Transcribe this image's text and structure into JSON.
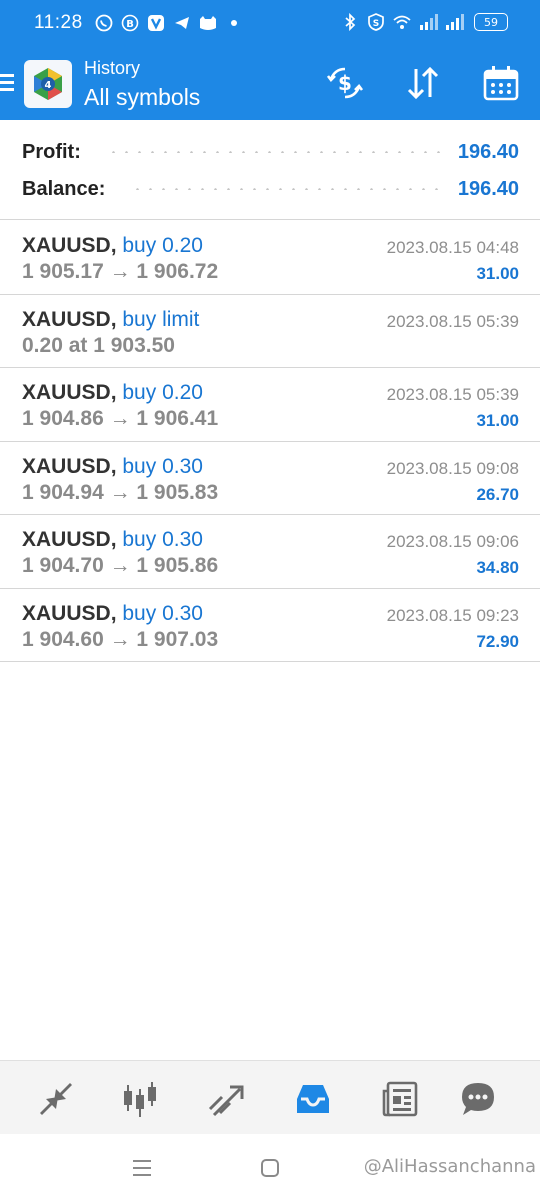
{
  "status_bar": {
    "time": "11:28",
    "battery": "59",
    "left_icons": [
      "whatsapp-icon",
      "b-icon",
      "v-icon",
      "telegram-icon",
      "cat-icon",
      "dot-icon"
    ],
    "right_icons": [
      "bluetooth-icon",
      "vpn-shield-icon",
      "wifi-icon",
      "signal-icon",
      "signal-icon",
      "battery-icon"
    ]
  },
  "header": {
    "title": "History",
    "subtitle": "All symbols",
    "actions": [
      "currency-exchange-icon",
      "sort-icon",
      "calendar-icon"
    ]
  },
  "summary": {
    "profit_label": "Profit:",
    "profit_value": "196.40",
    "balance_label": "Balance:",
    "balance_value": "196.40"
  },
  "deals": [
    {
      "symbol": "XAUUSD",
      "comma": ",",
      "side": "buy 0.20",
      "prices": "1 905.17 → 1 906.72",
      "time": "2023.08.15 04:48",
      "profit": "31.00"
    },
    {
      "symbol": "XAUUSD",
      "comma": ",",
      "side": "buy limit",
      "prices": "0.20 at 1 903.50",
      "time": "2023.08.15 05:39",
      "profit": ""
    },
    {
      "symbol": "XAUUSD",
      "comma": ",",
      "side": "buy 0.20",
      "prices": "1 904.86 → 1 906.41",
      "time": "2023.08.15 05:39",
      "profit": "31.00"
    },
    {
      "symbol": "XAUUSD",
      "comma": ",",
      "side": "buy 0.30",
      "prices": "1 904.94 → 1 905.83",
      "time": "2023.08.15 09:08",
      "profit": "26.70"
    },
    {
      "symbol": "XAUUSD",
      "comma": ",",
      "side": "buy 0.30",
      "prices": "1 904.70 → 1 905.86",
      "time": "2023.08.15 09:06",
      "profit": "34.80"
    },
    {
      "symbol": "XAUUSD",
      "comma": ",",
      "side": "buy 0.30",
      "prices": "1 904.60 → 1 907.03",
      "time": "2023.08.15 09:23",
      "profit": "72.90"
    }
  ],
  "bottom_nav": {
    "items": [
      "quotes-icon",
      "chart-icon",
      "trade-icon",
      "history-icon",
      "news-icon",
      "messages-icon"
    ],
    "active": "history-icon"
  },
  "system_nav": {
    "watermark": "@AliHassanchanna"
  },
  "colors": {
    "brand_blue": "#1e88e5",
    "value_blue": "#1976d2",
    "active_tab": "#1e88e5"
  }
}
